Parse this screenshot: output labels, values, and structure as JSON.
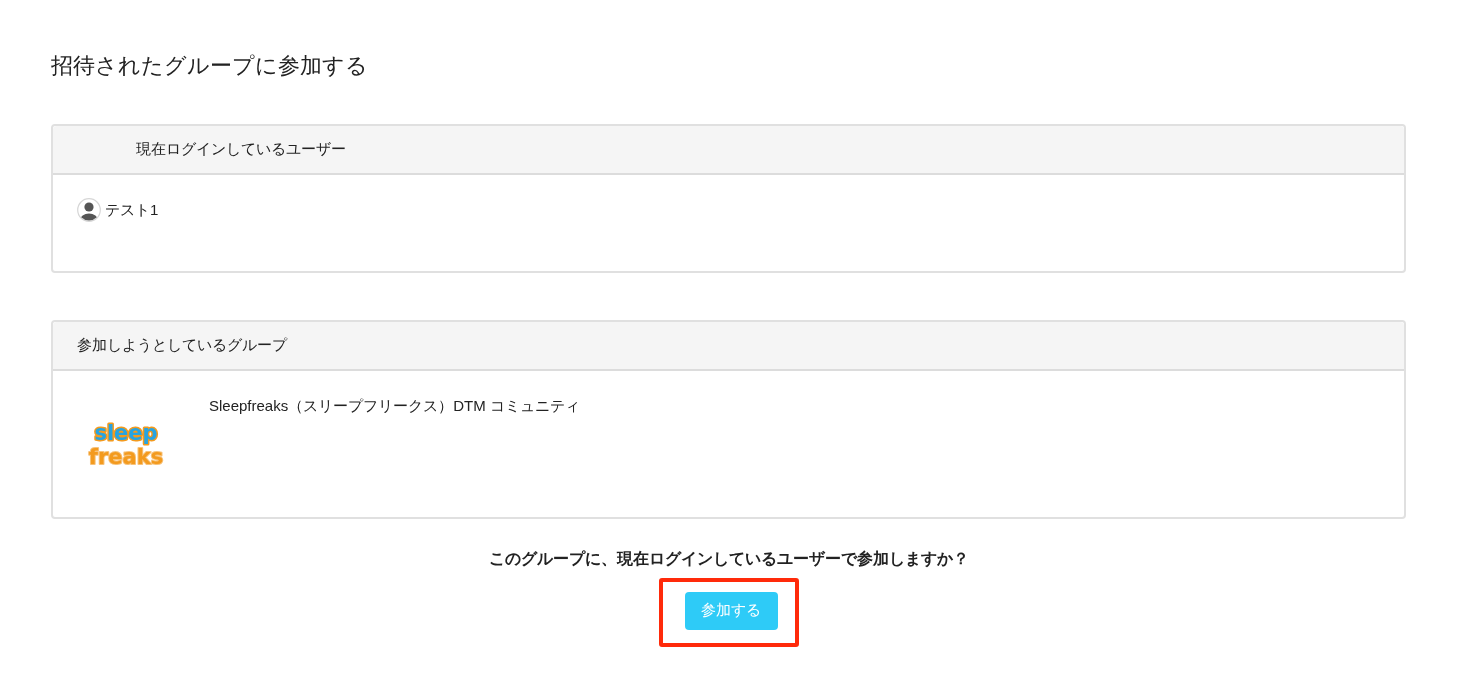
{
  "page": {
    "title": "招待されたグループに参加する"
  },
  "current_user_panel": {
    "heading": "現在ログインしているユーザー",
    "user_name": "テスト1"
  },
  "group_panel": {
    "heading": "参加しようとしているグループ",
    "logo": {
      "line_1": "sleep",
      "line_2": "freaks"
    },
    "group_name": "Sleepfreaks（スリープフリークス）DTM コミュニティ"
  },
  "confirmation": {
    "question": "このグループに、現在ログインしているユーザーで参加しますか？",
    "button": {
      "label": "参加する",
      "highlighted": true
    }
  }
}
